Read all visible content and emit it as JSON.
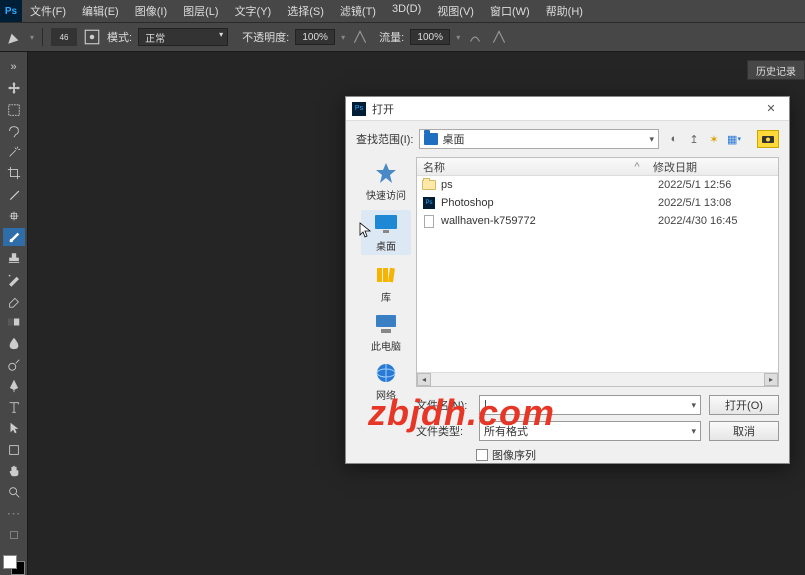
{
  "menubar": {
    "items": [
      "文件(F)",
      "编辑(E)",
      "图像(I)",
      "图层(L)",
      "文字(Y)",
      "选择(S)",
      "滤镜(T)",
      "3D(D)",
      "视图(V)",
      "窗口(W)",
      "帮助(H)"
    ]
  },
  "options": {
    "mode_label": "模式:",
    "mode_value": "正常",
    "opacity_label": "不透明度:",
    "opacity_value": "100%",
    "flow_label": "流量:",
    "flow_value": "100%",
    "brush_size": "46"
  },
  "panels": {
    "history": "历史记录"
  },
  "dialog": {
    "title": "打开",
    "lookup_label": "查找范围(I):",
    "lookup_value": "桌面",
    "places": {
      "quick": "快速访问",
      "desktop": "桌面",
      "library": "库",
      "thispc": "此电脑",
      "network": "网络"
    },
    "columns": {
      "name": "名称",
      "date": "修改日期",
      "sort": "^"
    },
    "files": [
      {
        "icon": "folder",
        "name": "ps",
        "date": "2022/5/1 12:56"
      },
      {
        "icon": "psd",
        "name": "Photoshop",
        "date": "2022/5/1 13:08"
      },
      {
        "icon": "file",
        "name": "wallhaven-k759772",
        "date": "2022/4/30 16:45"
      }
    ],
    "filename_label": "文件名(N):",
    "filename_value": "",
    "filetype_label": "文件类型:",
    "filetype_value": "所有格式",
    "open_btn": "打开(O)",
    "cancel_btn": "取消",
    "seq_checkbox": "图像序列"
  },
  "watermark": "zbjdh.com"
}
